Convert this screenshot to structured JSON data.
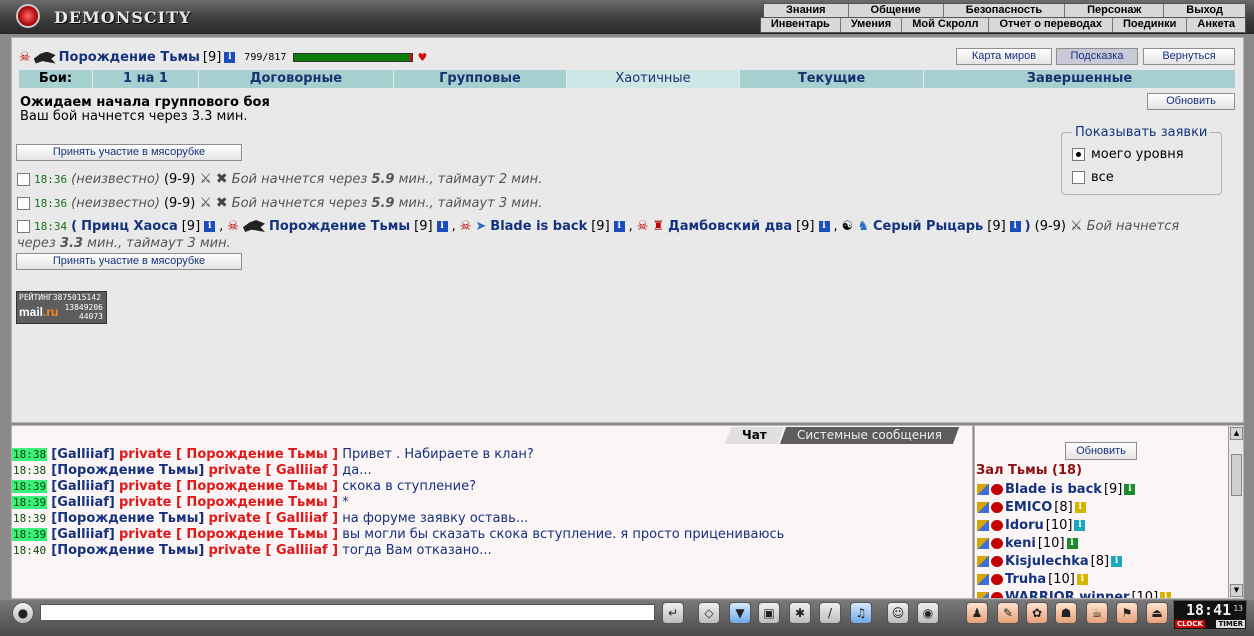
{
  "app": {
    "logo_text": "DEMONSCITY"
  },
  "topmenu": {
    "row1": [
      "Знания",
      "Общение",
      "Безопасность",
      "Персонаж",
      "Выход"
    ],
    "row2": [
      "Инвентарь",
      "Умения",
      "Мой Скролл",
      "Отчет о переводах",
      "Поединки",
      "Анкета"
    ]
  },
  "player": {
    "name": "Порождение Тьмы",
    "level": "[9]",
    "info_glyph": "i",
    "hp": "799/817",
    "hp_fraction": 0.978
  },
  "header_buttons": {
    "map": "Карта миров",
    "hint": "Подсказка",
    "back": "Вернуться"
  },
  "tabs": [
    "Бои:",
    "1 на 1",
    "Договорные",
    "Групповые",
    "Хаотичные",
    "Текущие",
    "Завершенные"
  ],
  "status": {
    "title": "Ожидаем начала группового боя",
    "subtitle": "Ваш бой начнется через 3.3 мин.",
    "refresh": "Обновить"
  },
  "filter": {
    "legend": "Показывать заявки",
    "options": [
      "моего уровня",
      "все"
    ],
    "selected": 0
  },
  "join_button": "Принять участие в мясорубке",
  "fights": [
    {
      "time": "18:36",
      "who": "(неизвестно)",
      "range": "(9-9)",
      "starts_pre": "Бой начнется через",
      "starts_val": "5.9",
      "starts_post": "мин., таймаут 2 мин."
    },
    {
      "time": "18:36",
      "who": "(неизвестно)",
      "range": "(9-9)",
      "starts_pre": "Бой начнется через",
      "starts_val": "5.9",
      "starts_post": "мин., таймаут 3 мин."
    }
  ],
  "fight3": {
    "time": "18:34",
    "open_paren": "(",
    "close_paren": ")",
    "sep": ",",
    "players": [
      {
        "name": "Принц Хаоса",
        "level": "[9]"
      },
      {
        "name": "Порождение Тьмы",
        "level": "[9]"
      },
      {
        "name": "Blade is back",
        "level": "[9]"
      },
      {
        "name": "Дамбовский два",
        "level": "[9]"
      },
      {
        "name": "Серый Рыцарь",
        "level": "[9]"
      }
    ],
    "range": "(9-9)",
    "starts_pre": "Бой начнется",
    "cont_pre": "через",
    "starts_val": "3.3",
    "starts_post": "мин., таймаут 3 мин."
  },
  "rating": {
    "label": "РЕЙТИНГ",
    "num1": "3875015142",
    "num2": "13849206",
    "num3": "44073",
    "mail_a": "mail",
    "mail_b": ".ru"
  },
  "chat": {
    "tabs": [
      "Чат",
      "Системные сообщения"
    ],
    "private_word": "private",
    "lines": [
      {
        "time": "18:38",
        "hl": true,
        "from": "[Galliiaf]",
        "to": "[ Порождение Тьмы ]",
        "text": "Привет . Набираете в клан?"
      },
      {
        "time": "18:38",
        "hl": false,
        "from": "[Порождение Тьмы]",
        "to": "[ Galliiaf ]",
        "text": "да..."
      },
      {
        "time": "18:39",
        "hl": true,
        "from": "[Galliiaf]",
        "to": "[ Порождение Тьмы ]",
        "text": "скока в ступление?"
      },
      {
        "time": "18:39",
        "hl": true,
        "from": "[Galliiaf]",
        "to": "[ Порождение Тьмы ]",
        "text": "*"
      },
      {
        "time": "18:39",
        "hl": false,
        "from": "[Порождение Тьмы]",
        "to": "[ Galliiaf ]",
        "text": "на форуме заявку оставь..."
      },
      {
        "time": "18:39",
        "hl": true,
        "from": "[Galliiaf]",
        "to": "[ Порождение Тьмы ]",
        "text": "вы могли бы сказать скока вступление. я просто прицениваюсь"
      },
      {
        "time": "18:40",
        "hl": false,
        "from": "[Порождение Тьмы]",
        "to": "[ Galliiaf ]",
        "text": "тогда Вам отказано..."
      }
    ]
  },
  "online": {
    "refresh": "Обновить",
    "title": "Зал Тьмы (18)",
    "users": [
      {
        "name": "Blade is back",
        "level": "[9]",
        "badge": "g"
      },
      {
        "name": "EMICO",
        "level": "[8]",
        "badge": "y"
      },
      {
        "name": "Idoru",
        "level": "[10]",
        "badge": "c"
      },
      {
        "name": "keni",
        "level": "[10]",
        "badge": "g"
      },
      {
        "name": "Kisjulechka",
        "level": "[8]",
        "badge": "c"
      },
      {
        "name": "Truha",
        "level": "[10]",
        "badge": "y"
      },
      {
        "name": "WARRIOR winner",
        "level": "[10]",
        "badge": "y"
      }
    ]
  },
  "clock": {
    "time": "18:41",
    "sec": "13",
    "clock_label": "CLOCK",
    "timer_label": "TIMER"
  },
  "colors": {
    "tab_bg": "#a6cfcf",
    "nick": "#14327d",
    "private": "#e01818",
    "hall_title": "#8b1010"
  }
}
